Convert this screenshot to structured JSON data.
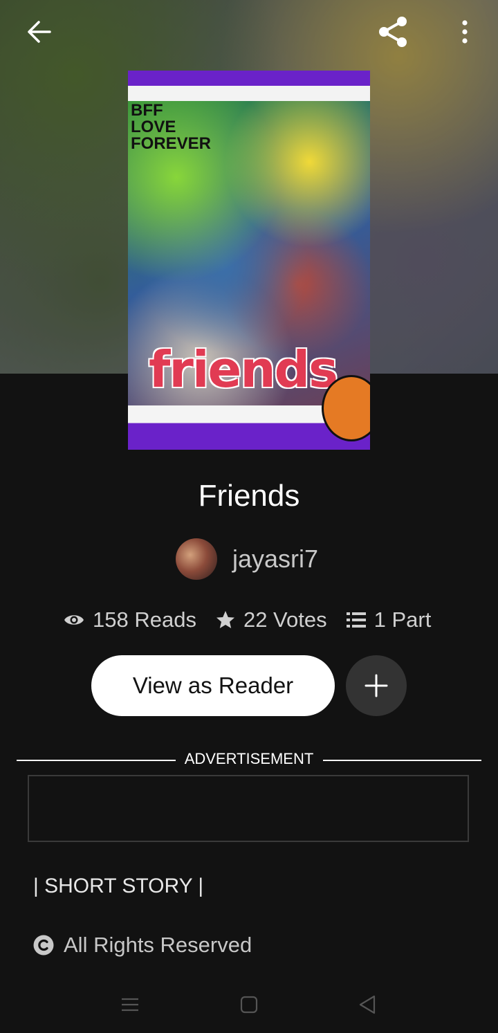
{
  "header": {
    "back_icon": "arrow-left-icon",
    "share_icon": "share-icon",
    "more_icon": "more-vertical-icon"
  },
  "cover": {
    "title_art": "friends",
    "tagline_art": "BFF LOVE FOREVER"
  },
  "story": {
    "title": "Friends",
    "author": "jayasri7"
  },
  "stats": {
    "reads": "158 Reads",
    "votes": "22 Votes",
    "parts": "1 Part"
  },
  "actions": {
    "view_as_reader": "View as Reader",
    "add_icon": "plus-icon"
  },
  "ad": {
    "label": "ADVERTISEMENT"
  },
  "details": {
    "tag_line": "| SHORT STORY |",
    "copyright": "All Rights Reserved"
  },
  "nav": {
    "menu_icon": "menu-icon",
    "home_icon": "square-icon",
    "back_icon": "triangle-back-icon"
  },
  "colors": {
    "background": "#121212",
    "cover_purple": "#6a22c9",
    "button_bg": "#ffffff",
    "plus_bg": "#333333"
  }
}
